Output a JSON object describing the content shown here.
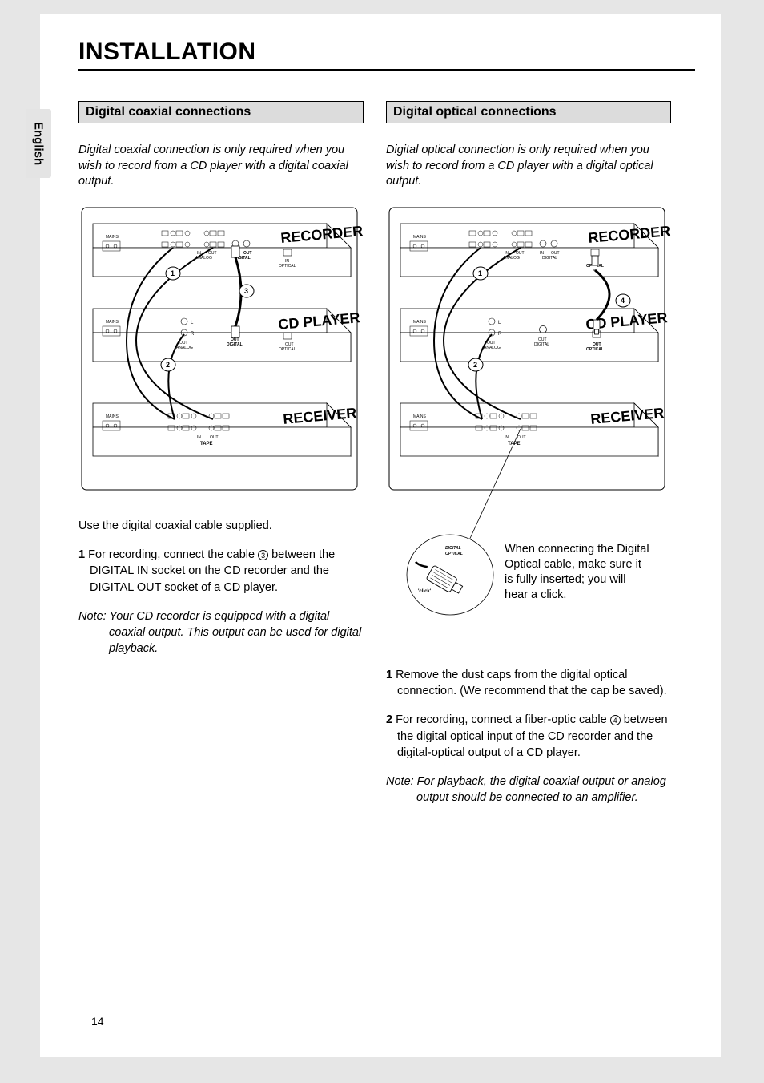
{
  "header": {
    "title": "INSTALLATION"
  },
  "lang_tab": "English",
  "page_number": "14",
  "left": {
    "section_title": "Digital coaxial connections",
    "intro": "Digital coaxial connection is only required when you wish to record from a CD player with a digital coaxial output.",
    "lead": "Use the digital coaxial cable supplied.",
    "step1_num": "1",
    "step1_a": " For recording, connect the cable ",
    "step1_cable": "3",
    "step1_b": " between the DIGITAL IN socket on the CD recorder and the DIGITAL OUT socket of a CD player.",
    "note": "Note: Your CD recorder is equipped with a digital coaxial output. This output can be used for digital playback.",
    "diagram": {
      "recorder": "RECORDER",
      "cdplayer": "CD PLAYER",
      "receiver": "RECEIVER",
      "mains": "MAINS",
      "in": "IN",
      "out": "OUT",
      "analog": "ANALOG",
      "digital_in": "IN",
      "digital_out": "OUT",
      "digital": "DIGITAL",
      "optical_in": "IN",
      "optical": "OPTICAL",
      "l": "L",
      "r": "R",
      "out_analog": "OUT",
      "out_analog2": "ANALOG",
      "out_digital": "OUT",
      "out_digital2": "DIGITAL",
      "out_optical": "OUT",
      "out_optical2": "OPTICAL",
      "tape": "TAPE",
      "n1": "1",
      "n2": "2",
      "n3": "3"
    }
  },
  "right": {
    "section_title": "Digital optical connections",
    "intro": "Digital optical connection is only required when you wish to record from a CD player with a digital optical output.",
    "callout": "When connecting the Digital Optical cable, make sure it is fully inserted; you will hear a click.",
    "step1_num": "1",
    "step1": " Remove the dust caps from the digital optical connection. (We recommend that the cap be saved).",
    "step2_num": "2",
    "step2_a": " For recording, connect a fiber-optic cable ",
    "step2_cable": "4",
    "step2_b": " between the digital optical input of the CD recorder and the digital-optical output of a CD player.",
    "note": "Note: For playback, the digital coaxial output or analog output should be connected to an amplifier.",
    "diagram": {
      "recorder": "RECORDER",
      "cdplayer": "CD PLAYER",
      "receiver": "RECEIVER",
      "mains": "MAINS",
      "in": "IN",
      "out": "OUT",
      "analog": "ANALOG",
      "digital_in": "IN",
      "digital_out": "OUT",
      "digital": "DIGITAL",
      "optical_in": "IN",
      "optical_out": "OUT",
      "optical": "OPTICAL",
      "l": "L",
      "r": "R",
      "out_analog": "OUT",
      "out_analog2": "ANALOG",
      "out_digital": "OUT",
      "out_digital2": "DIGITAL",
      "out_optical": "OUT",
      "out_optical2": "OPTICAL",
      "tape": "TAPE",
      "n1": "1",
      "n2": "2",
      "n4": "4",
      "plug_label1": "DIGITAL",
      "plug_label2": "OPTICAL",
      "click": "'click'"
    }
  }
}
